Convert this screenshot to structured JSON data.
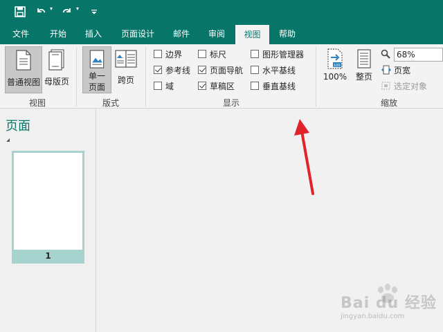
{
  "quick_access": {
    "icons": [
      "save-icon",
      "undo-icon",
      "redo-icon",
      "customize-qat-icon"
    ]
  },
  "tabs": [
    "文件",
    "开始",
    "插入",
    "页面设计",
    "邮件",
    "审阅",
    "视图",
    "帮助"
  ],
  "active_tab": "视图",
  "ribbon": {
    "view_group": {
      "label": "视图",
      "normal_view": "普通视图",
      "master_page": "母版页"
    },
    "layout_group": {
      "label": "版式",
      "single_page_line1": "单一",
      "single_page_line2": "页面",
      "two_page": "跨页"
    },
    "show_group": {
      "label": "显示",
      "checkboxes": [
        {
          "label": "边界",
          "checked": false
        },
        {
          "label": "参考线",
          "checked": true
        },
        {
          "label": "域",
          "checked": false
        },
        {
          "label": "标尺",
          "checked": false
        },
        {
          "label": "页面导航",
          "checked": true
        },
        {
          "label": "草稿区",
          "checked": true
        },
        {
          "label": "图形管理器",
          "checked": false
        },
        {
          "label": "水平基线",
          "checked": false
        },
        {
          "label": "垂直基线",
          "checked": false
        }
      ]
    },
    "zoom_group": {
      "label": "缩放",
      "hundred_percent": "100%",
      "whole_page": "整页",
      "zoom_value": "68%",
      "page_width": "页宽",
      "selected_objects": "选定对象"
    }
  },
  "pane": {
    "title": "页面",
    "page_number": "1"
  },
  "colors": {
    "accent": "#077568",
    "arrow": "#e0242a",
    "thumb_frame": "#a6d3cd"
  },
  "watermark": {
    "brand": "Bai du 经验",
    "url": "jingyan.baidu.com"
  }
}
